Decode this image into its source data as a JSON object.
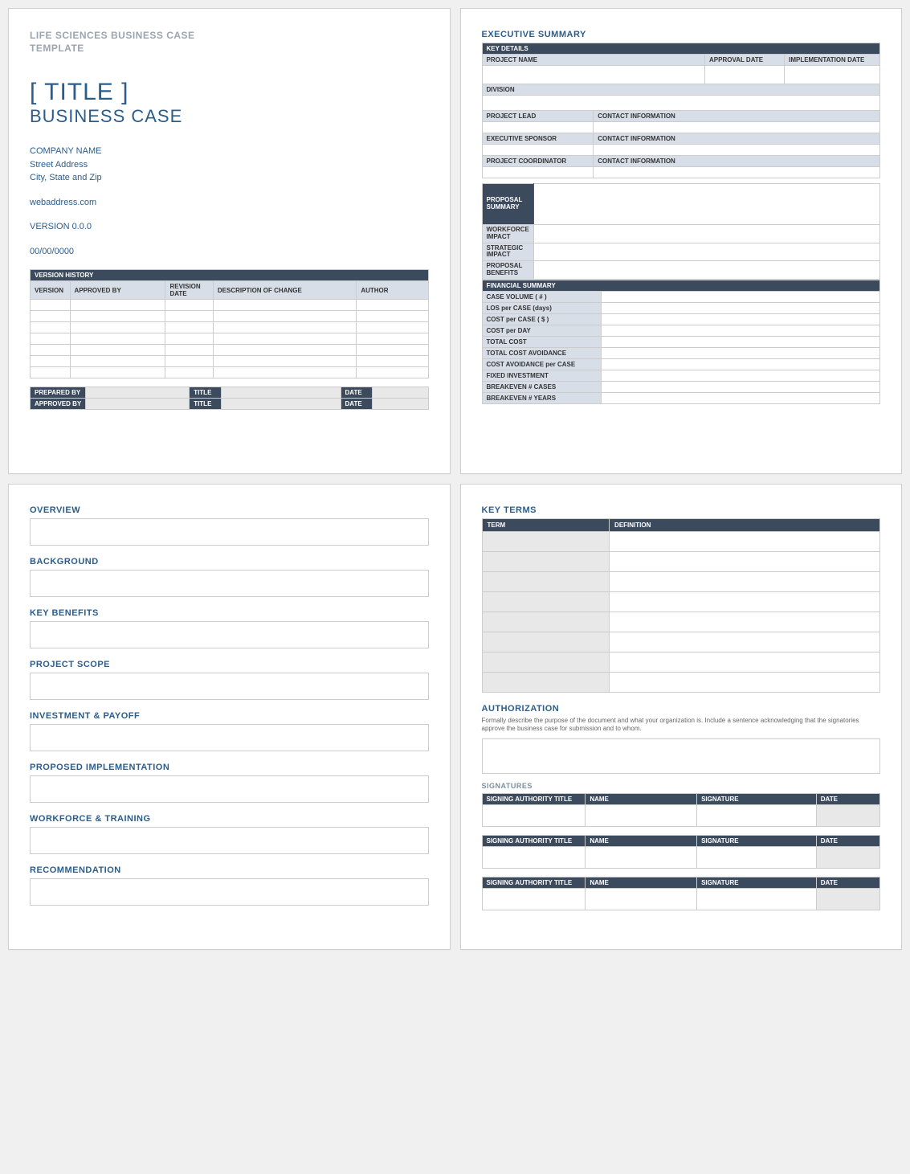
{
  "page1": {
    "doc_label_l1": "LIFE SCIENCES BUSINESS CASE",
    "doc_label_l2": "TEMPLATE",
    "title": "[ TITLE ]",
    "subtitle": "BUSINESS CASE",
    "company": "COMPANY NAME",
    "addr1": "Street Address",
    "addr2": "City, State and Zip",
    "web": "webaddress.com",
    "version": "VERSION 0.0.0",
    "date": "00/00/0000",
    "vh_title": "VERSION HISTORY",
    "vh_cols": {
      "c1": "VERSION",
      "c2": "APPROVED BY",
      "c3": "REVISION DATE",
      "c4": "DESCRIPTION OF CHANGE",
      "c5": "AUTHOR"
    },
    "sign": {
      "prepared": "PREPARED BY",
      "approved": "APPROVED BY",
      "title": "TITLE",
      "date": "DATE"
    }
  },
  "page2": {
    "heading": "EXECUTIVE SUMMARY",
    "key_details": "KEY DETAILS",
    "project_name": "PROJECT NAME",
    "approval_date": "APPROVAL DATE",
    "impl_date": "IMPLEMENTATION DATE",
    "division": "DIVISION",
    "project_lead": "PROJECT LEAD",
    "contact": "CONTACT INFORMATION",
    "exec_sponsor": "EXECUTIVE SPONSOR",
    "coordinator": "PROJECT COORDINATOR",
    "rows": {
      "proposal_summary": "PROPOSAL SUMMARY",
      "workforce": "WORKFORCE IMPACT",
      "strategic": "STRATEGIC IMPACT",
      "benefits": "PROPOSAL BENEFITS"
    },
    "fin_heading": "FINANCIAL SUMMARY",
    "fin": {
      "r1": "CASE VOLUME ( # )",
      "r2": "LOS per CASE (days)",
      "r3": "COST per CASE ( $ )",
      "r4": "COST per DAY",
      "r5": "TOTAL COST",
      "r6": "TOTAL COST AVOIDANCE",
      "r7": "COST AVOIDANCE per CASE",
      "r8": "FIXED INVESTMENT",
      "r9": "BREAKEVEN # CASES",
      "r10": "BREAKEVEN # YEARS"
    }
  },
  "page3": {
    "s1": "OVERVIEW",
    "s2": "BACKGROUND",
    "s3": "KEY BENEFITS",
    "s4": "PROJECT SCOPE",
    "s5": "INVESTMENT & PAYOFF",
    "s6": "PROPOSED IMPLEMENTATION",
    "s7": "WORKFORCE & TRAINING",
    "s8": "RECOMMENDATION"
  },
  "page4": {
    "kt_heading": "KEY TERMS",
    "kt_cols": {
      "c1": "TERM",
      "c2": "DEFINITION"
    },
    "auth_heading": "AUTHORIZATION",
    "auth_note": "Formally describe the purpose of the document and what your organization is. Include a sentence acknowledging that the signatories approve the business case for submission and to whom.",
    "sig_heading": "SIGNATURES",
    "sig_cols": {
      "c1": "SIGNING AUTHORITY TITLE",
      "c2": "NAME",
      "c3": "SIGNATURE",
      "c4": "DATE"
    }
  }
}
